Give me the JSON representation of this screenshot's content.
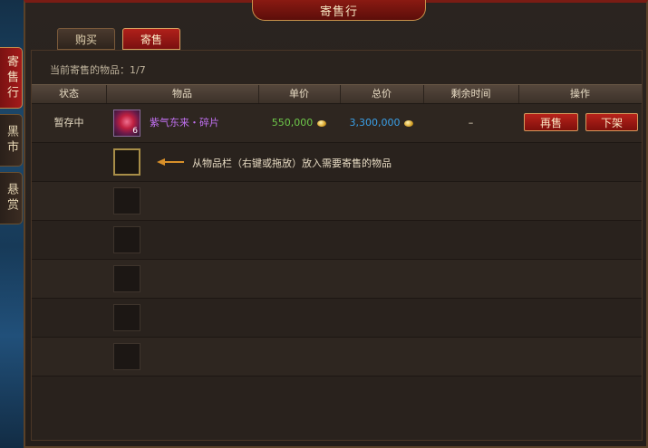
{
  "window": {
    "title": "寄售行"
  },
  "side_tabs": [
    {
      "label": "寄售行",
      "active": true
    },
    {
      "label": "黑市",
      "active": false
    },
    {
      "label": "悬赏",
      "active": false
    }
  ],
  "tabs": [
    {
      "label": "购买",
      "active": false
    },
    {
      "label": "寄售",
      "active": true
    }
  ],
  "listing_count": {
    "label": "当前寄售的物品：",
    "value": "1/7"
  },
  "table": {
    "columns": [
      "状态",
      "物品",
      "单价",
      "总价",
      "剩余时间",
      "操作"
    ],
    "rows": [
      {
        "status": "暂存中",
        "item_name": "紫气东来・碎片",
        "item_count": "6",
        "unit_price": "550,000",
        "total_price": "3,300,000",
        "remaining": "–",
        "actions": [
          "再售",
          "下架"
        ]
      }
    ]
  },
  "hint": "从物品栏（右键或拖放）放入需要寄售的物品",
  "colors": {
    "accent_red": "#a41a1a",
    "item_name": "#c070f0",
    "unit_price": "#6ec84a",
    "total_price": "#3aa0e8"
  }
}
